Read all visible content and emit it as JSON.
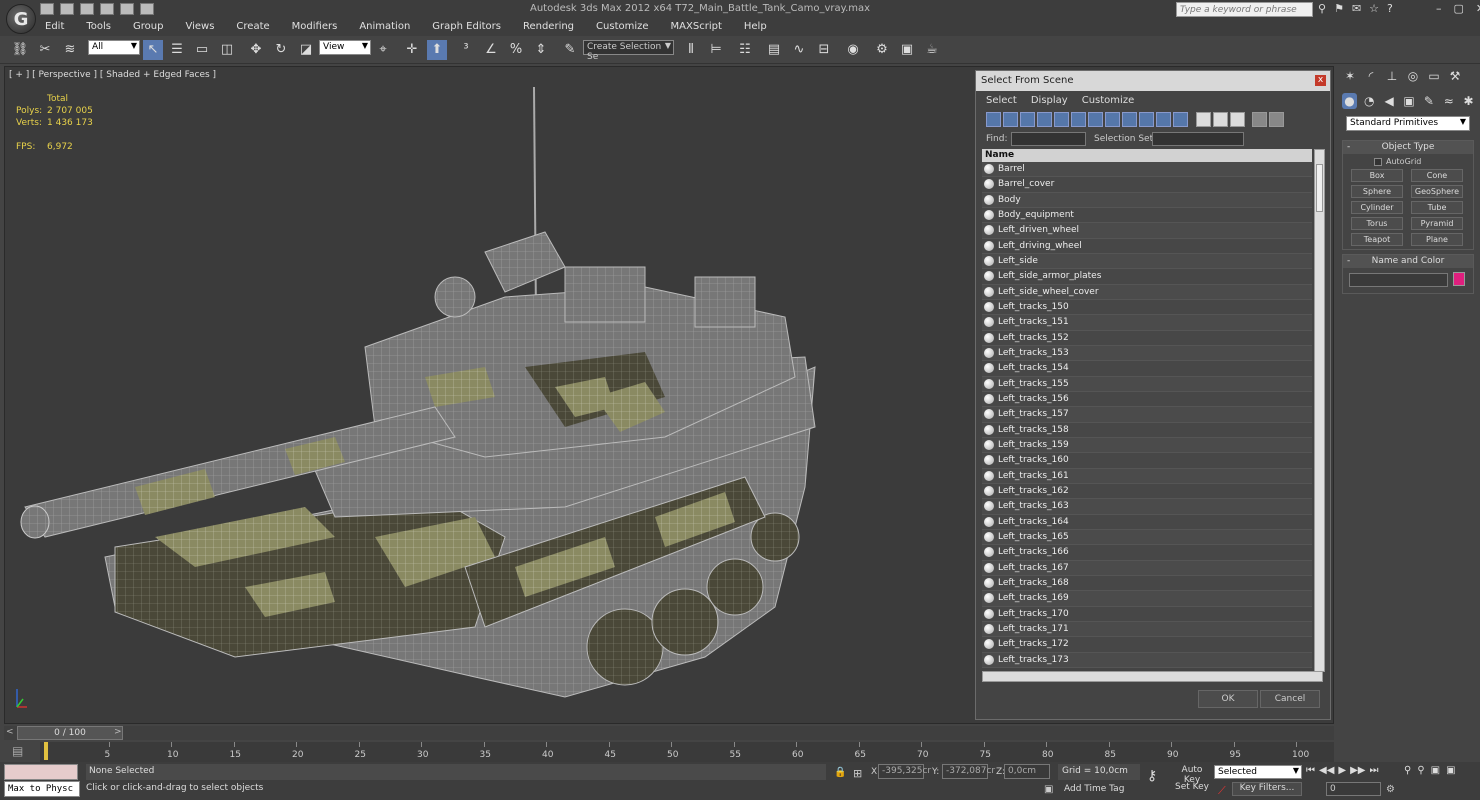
{
  "app": {
    "window_title": "Autodesk 3ds Max  2012 x64      T72_Main_Battle_Tank_Camo_vray.max",
    "search_placeholder": "Type a keyword or phrase"
  },
  "menu": [
    "Edit",
    "Tools",
    "Group",
    "Views",
    "Create",
    "Modifiers",
    "Animation",
    "Graph Editors",
    "Rendering",
    "Customize",
    "MAXScript",
    "Help"
  ],
  "toolbar": {
    "filter_value": "All",
    "coord_value": "View",
    "selection_set_value": "Create Selection Se"
  },
  "viewport": {
    "label": "[ + ] [ Perspective ] [ Shaded + Edged Faces ]",
    "stats_total": "Total",
    "polys_label": "Polys:",
    "polys_value": "2 707 005",
    "verts_label": "Verts:",
    "verts_value": "1 436 173",
    "fps_label": "FPS:",
    "fps_value": "6,972"
  },
  "dialog": {
    "title": "Select From Scene",
    "close": "x",
    "menu": [
      "Select",
      "Display",
      "Customize"
    ],
    "find_label": "Find:",
    "selection_set_label": "Selection Set:",
    "column_header": "Name",
    "items": [
      "Barrel",
      "Barrel_cover",
      "Body",
      "Body_equipment",
      "Left_driven_wheel",
      "Left_driving_wheel",
      "Left_side",
      "Left_side_armor_plates",
      "Left_side_wheel_cover",
      "Left_tracks_150",
      "Left_tracks_151",
      "Left_tracks_152",
      "Left_tracks_153",
      "Left_tracks_154",
      "Left_tracks_155",
      "Left_tracks_156",
      "Left_tracks_157",
      "Left_tracks_158",
      "Left_tracks_159",
      "Left_tracks_160",
      "Left_tracks_161",
      "Left_tracks_162",
      "Left_tracks_163",
      "Left_tracks_164",
      "Left_tracks_165",
      "Left_tracks_166",
      "Left_tracks_167",
      "Left_tracks_168",
      "Left_tracks_169",
      "Left_tracks_170",
      "Left_tracks_171",
      "Left_tracks_172",
      "Left_tracks_173"
    ],
    "ok_label": "OK",
    "cancel_label": "Cancel"
  },
  "command_panel": {
    "category": "Standard Primitives",
    "object_type_header": "Object Type",
    "autogrid": "AutoGrid",
    "primitives": [
      "Box",
      "Cone",
      "Sphere",
      "GeoSphere",
      "Cylinder",
      "Tube",
      "Torus",
      "Pyramid",
      "Teapot",
      "Plane"
    ],
    "name_color_header": "Name and Color",
    "swatch_color": "#e01f7e"
  },
  "timeline": {
    "frame_display": "0 / 100",
    "ticks": [
      "5",
      "10",
      "15",
      "20",
      "25",
      "30",
      "35",
      "40",
      "45",
      "50",
      "55",
      "60",
      "65",
      "70",
      "75",
      "80",
      "85",
      "90",
      "95",
      "100"
    ]
  },
  "status": {
    "maxscript": "Max to Physc",
    "selection": "None Selected",
    "prompt": "Click or click-and-drag to select objects",
    "x_label": "X:",
    "x_value": "-395,325cr",
    "y_label": "Y:",
    "y_value": "-372,087cr",
    "z_label": "Z:",
    "z_value": "0,0cm",
    "grid": "Grid = 10,0cm",
    "add_time_tag": "Add Time Tag",
    "auto_key": "Auto Key",
    "set_key": "Set Key",
    "key_mode": "Selected",
    "key_filters": "Key Filters...",
    "current_frame": "0"
  }
}
